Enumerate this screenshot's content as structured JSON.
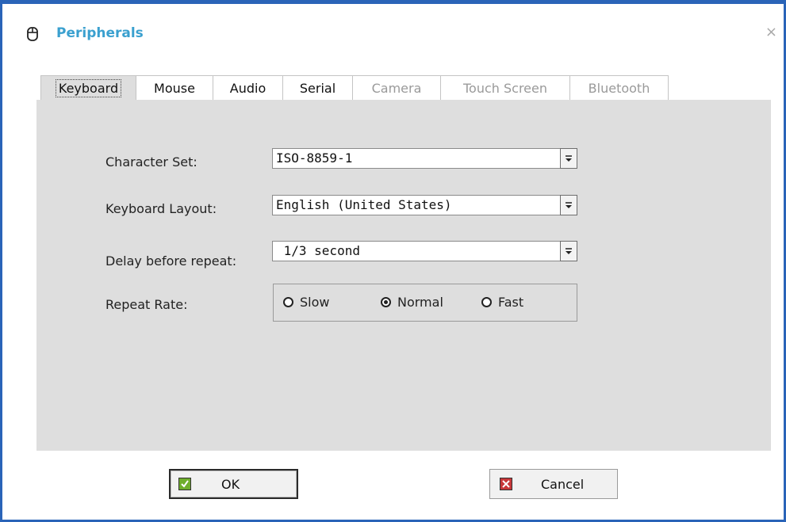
{
  "window": {
    "title": "Peripherals",
    "title_icon": "mouse-icon",
    "close_icon": "close-icon",
    "close_glyph": "×",
    "accent_color": "#3aa0cf",
    "frame_color": "#2a64b8"
  },
  "tabs": [
    {
      "label": "Keyboard",
      "state": "active"
    },
    {
      "label": "Mouse",
      "state": "enabled"
    },
    {
      "label": "Audio",
      "state": "enabled"
    },
    {
      "label": "Serial",
      "state": "enabled"
    },
    {
      "label": "Camera",
      "state": "disabled"
    },
    {
      "label": "Touch Screen",
      "state": "disabled"
    },
    {
      "label": "Bluetooth",
      "state": "disabled"
    }
  ],
  "keyboard": {
    "character_set": {
      "label": "Character Set:",
      "value": "ISO-8859-1"
    },
    "keyboard_layout": {
      "label": "Keyboard Layout:",
      "value": "English (United States)"
    },
    "delay_before_repeat": {
      "label": "Delay before repeat:",
      "value": " 1/3 second"
    },
    "repeat_rate": {
      "label": "Repeat Rate:",
      "options": [
        "Slow",
        "Normal",
        "Fast"
      ],
      "selected": "Normal"
    }
  },
  "buttons": {
    "ok": {
      "label": "OK",
      "icon": "checkmark-icon"
    },
    "cancel": {
      "label": "Cancel",
      "icon": "cancel-x-icon"
    }
  }
}
